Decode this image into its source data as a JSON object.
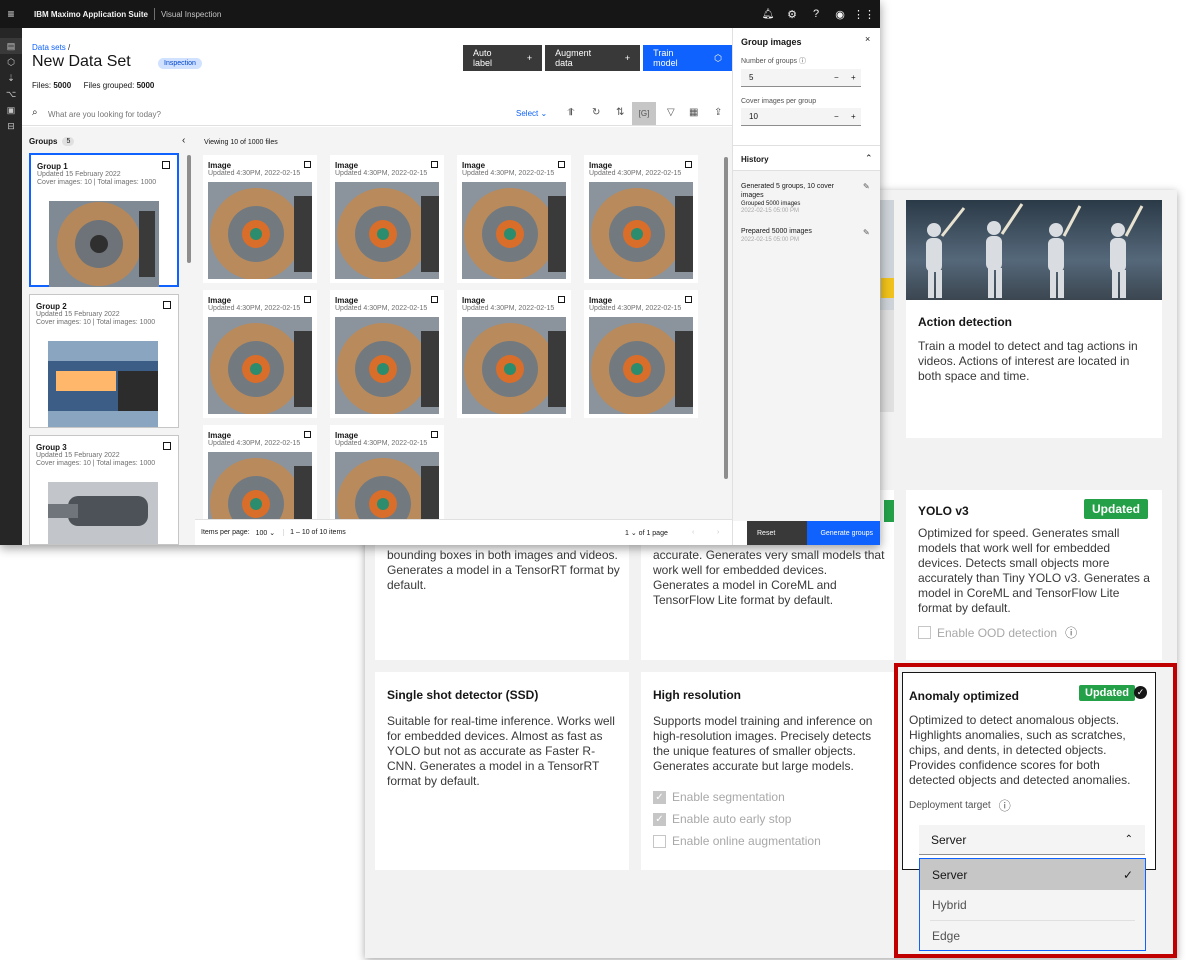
{
  "app": {
    "brand": "IBM Maximo Application Suite",
    "product": "Visual Inspection",
    "top_icons": [
      "notification-icon",
      "settings-icon",
      "help-icon",
      "user-icon",
      "app-switcher-icon"
    ]
  },
  "dataset": {
    "breadcrumb": "Data sets",
    "title": "New Data Set",
    "tag": "Inspection",
    "files_label": "Files:",
    "files_value": "5000",
    "grouped_label": "Files grouped:",
    "grouped_value": "5000",
    "buttons": {
      "auto_label": "Auto label",
      "augment": "Augment data",
      "train": "Train model"
    },
    "search_placeholder": "What are you looking for today?",
    "select_label": "Select"
  },
  "groups": {
    "label": "Groups",
    "count": "5",
    "items": [
      {
        "title": "Group 1",
        "updated": "Updated 15 February 2022",
        "cover": "Cover images: 10 | Total images: 1000"
      },
      {
        "title": "Group 2",
        "updated": "Updated 15 February 2022",
        "cover": "Cover images: 10 | Total images: 1000"
      },
      {
        "title": "Group 3",
        "updated": "Updated 15 February 2022",
        "cover": "Cover images: 10 | Total images: 1000"
      }
    ]
  },
  "gallery": {
    "viewing": "Viewing 10 of 1000 files",
    "tiles": [
      {
        "title": "Image",
        "sub": "Updated 4:30PM, 2022-02-15"
      },
      {
        "title": "Image",
        "sub": "Updated 4:30PM, 2022-02-15"
      },
      {
        "title": "Image",
        "sub": "Updated 4:30PM, 2022-02-15"
      },
      {
        "title": "Image",
        "sub": "Updated 4:30PM, 2022-02-15"
      },
      {
        "title": "Image",
        "sub": "Updated 4:30PM, 2022-02-15"
      },
      {
        "title": "Image",
        "sub": "Updated 4:30PM, 2022-02-15"
      },
      {
        "title": "Image",
        "sub": "Updated 4:30PM, 2022-02-15"
      },
      {
        "title": "Image",
        "sub": "Updated 4:30PM, 2022-02-15"
      },
      {
        "title": "Image",
        "sub": "Updated 4:30PM, 2022-02-15"
      },
      {
        "title": "Image",
        "sub": "Updated 4:30PM, 2022-02-15"
      }
    ],
    "items_per_page_label": "Items per page:",
    "items_per_page": "100",
    "range": "1 – 10 of 10 items",
    "page": "1",
    "of_pages": "of 1 page"
  },
  "group_panel": {
    "title": "Group images",
    "num_groups_label": "Number of groups",
    "num_groups": "5",
    "cover_label": "Cover images per group",
    "cover_value": "10",
    "history_title": "History",
    "history": [
      {
        "text": "Generated 5 groups, 10 cover images",
        "sub": "Grouped 5000 images",
        "time": "2022-02-15 05:00 PM"
      },
      {
        "text": "Prepared 5000 images",
        "sub": "",
        "time": "2022-02-15 05:00 PM"
      }
    ],
    "reset": "Reset",
    "generate": "Generate groups"
  },
  "models": {
    "action": {
      "title": "Action detection",
      "desc": "Train a model to detect and tag actions in videos. Actions of interest are located in both space and time."
    },
    "frcnn_tail": "bounding boxes in both images and videos. Generates a model in a TensorRT format by default.",
    "tiny_tail": "accurate. Generates very small models that work well for embedded devices. Generates a model in CoreML and TensorFlow Lite format by default.",
    "yolo": {
      "title": "YOLO v3",
      "badge": "Updated",
      "desc": "Optimized for speed. Generates small models that work well for embedded devices. Detects small objects more accurately than Tiny YOLO v3. Generates a model in CoreML and TensorFlow Lite format by default.",
      "ood": "Enable OOD detection"
    },
    "ssd": {
      "title": "Single shot detector (SSD)",
      "desc": "Suitable for real-time inference. Works well for embedded devices. Almost as fast as YOLO but not as accurate as Faster R-CNN. Generates a model in a TensorRT format by default."
    },
    "hires": {
      "title": "High resolution",
      "desc": "Supports model training and inference on high-resolution images. Precisely detects the unique features of smaller objects. Generates accurate but large models.",
      "opts": [
        "Enable segmentation",
        "Enable auto early stop",
        "Enable online augmentation"
      ]
    },
    "anomaly": {
      "title": "Anomaly optimized",
      "badge": "Updated",
      "desc": "Optimized to detect anomalous objects. Highlights anomalies, such as scratches, chips, and dents, in detected objects. Provides confidence scores for both detected objects and detected anomalies.",
      "target_label": "Deployment target",
      "selected": "Server",
      "options": [
        "Server",
        "Hybrid",
        "Edge"
      ]
    }
  },
  "colors": {
    "accent": "#0f62fe",
    "updated": "#24a148",
    "highlight": "#c00000"
  }
}
